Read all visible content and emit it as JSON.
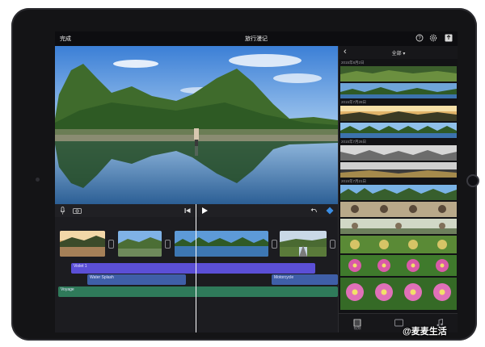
{
  "topbar": {
    "done_label": "完成",
    "project_title": "旅行漫记",
    "help_icon": "help-icon",
    "settings_icon": "gear-icon",
    "export_icon": "share-icon"
  },
  "timeline": {
    "audio_tracks": [
      {
        "label": "Violet 1",
        "color": "#5b4fd6"
      },
      {
        "label": "Water Splash",
        "color": "#3f5fa8"
      },
      {
        "label": "Motorcycle",
        "color": "#3f5fa8"
      },
      {
        "label": "Voyage",
        "color": "#2f7a5a"
      }
    ],
    "controls": [
      "microphone-icon",
      "camera-icon",
      "skip-back-icon",
      "play-icon",
      "undo-icon",
      "audio-icon"
    ]
  },
  "browser": {
    "filter_label": "全部 ▾",
    "dates": [
      "2015年8月2日",
      "2015年7月28日",
      "2015年7月26日",
      "2015年7月21日"
    ],
    "tabs": [
      {
        "label": "视频",
        "icon": "film-icon"
      },
      {
        "label": "",
        "icon": "photo-icon"
      },
      {
        "label": "",
        "icon": "music-icon"
      }
    ]
  },
  "watermark": "@麦麦生活",
  "colors": {
    "accent": "#3a8ee6",
    "screen_bg": "#1b1b1e",
    "device": "#141416"
  }
}
